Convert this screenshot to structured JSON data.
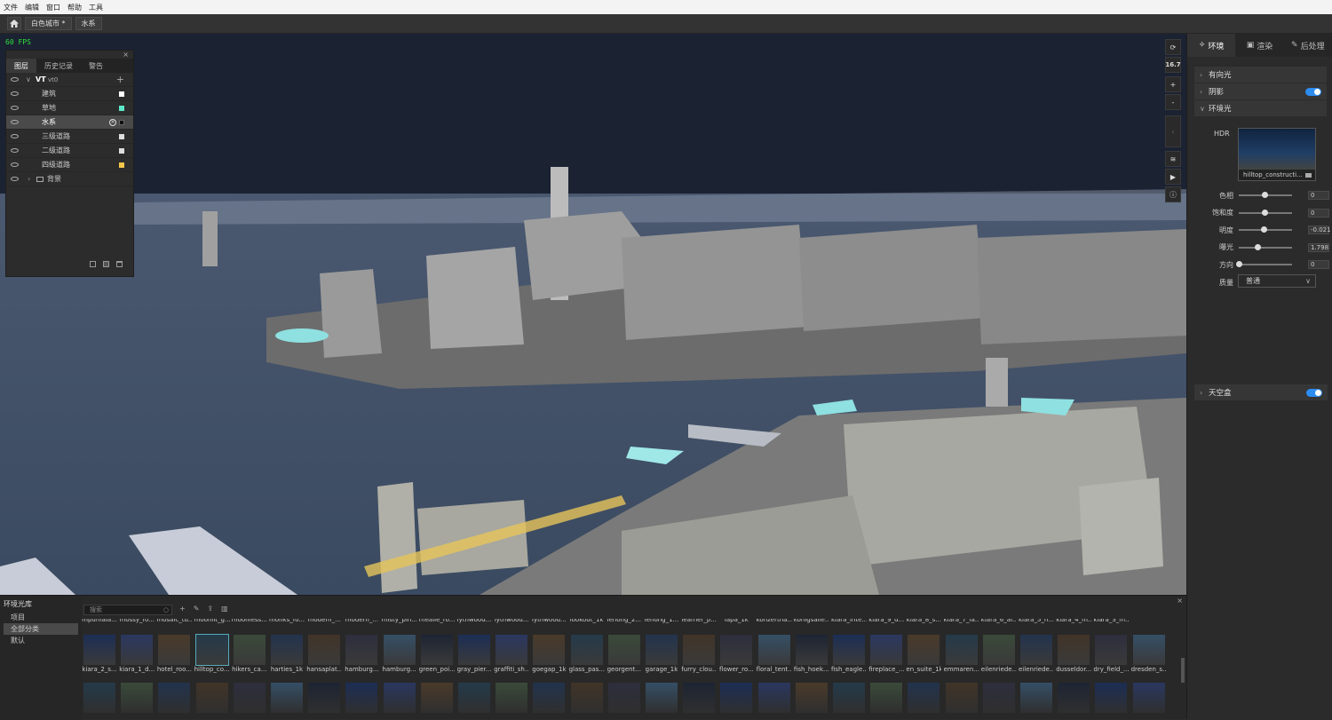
{
  "menu": [
    "文件",
    "编辑",
    "窗口",
    "帮助",
    "工具"
  ],
  "breadcrumb": {
    "city": "白色城市 *",
    "layer": "水系"
  },
  "viewport": {
    "fps": "60 FPS",
    "speed": "16.7"
  },
  "layers": {
    "tabs": [
      "图层",
      "历史记录",
      "警告"
    ],
    "root": {
      "name": "VT",
      "sub": "vt0"
    },
    "items": [
      {
        "label": "建筑",
        "color": "#ffffff"
      },
      {
        "label": "草地",
        "color": "#5ce6c9"
      },
      {
        "label": "水系",
        "color": "#111111"
      },
      {
        "label": "三级道路",
        "color": "#dddddd"
      },
      {
        "label": "二级道路",
        "color": "#dddddd"
      },
      {
        "label": "四级道路",
        "color": "#f2c64a"
      }
    ],
    "background": "背景"
  },
  "right": {
    "tabs": [
      "环境",
      "渲染",
      "后处理"
    ],
    "sections": {
      "directional": "有向光",
      "shadow": "阴影",
      "ambient": "环境光",
      "skybox": "天空盒"
    },
    "hdr_label": "HDR",
    "hdr_name": "hilltop_constructi...",
    "sliders": [
      {
        "label": "色相",
        "value": "0",
        "pos": 0.48
      },
      {
        "label": "饱和度",
        "value": "0",
        "pos": 0.48
      },
      {
        "label": "明度",
        "value": "-0.021",
        "pos": 0.47
      },
      {
        "label": "曝光",
        "value": "1.798",
        "pos": 0.35
      },
      {
        "label": "方向",
        "value": "0",
        "pos": 0.0
      }
    ],
    "quality_label": "质量",
    "quality_value": "普通"
  },
  "library": {
    "title": "环境光库",
    "search_placeholder": "搜索",
    "categories": [
      "项目",
      "全部分类",
      "默认"
    ],
    "row0": [
      "mpumala...",
      "mossy_fo...",
      "mosaic_tu...",
      "moonlit_g...",
      "moonless...",
      "monks_fo...",
      "modern_...",
      "modern_...",
      "misty_pin...",
      "mealie_ro...",
      "lythwood...",
      "lythwood...",
      "lythwood...",
      "lookout_1k",
      "lenong_2...",
      "lenong_1...",
      "learner_p...",
      "lapa_1k",
      "konzertha...",
      "konigsalle...",
      "kiara_inte...",
      "kiara_9_d...",
      "kiara_8_s...",
      "kiara_7_la...",
      "kiara_6_af...",
      "kiara_5_n...",
      "kiara_4_m...",
      "kiara_3_m..."
    ],
    "row1": [
      "kiara_2_s...",
      "kiara_1_d...",
      "hotel_roo...",
      "hilltop_co...",
      "hikers_ca...",
      "harties_1k",
      "hansaplat...",
      "hamburg...",
      "hamburg...",
      "green_poi...",
      "gray_pier...",
      "graffiti_sh...",
      "goegap_1k",
      "glass_pas...",
      "georgent...",
      "garage_1k",
      "furry_clou...",
      "flower_ro...",
      "floral_tent...",
      "fish_hoek...",
      "fish_eagle...",
      "fireplace_...",
      "en_suite_1k",
      "emmaren...",
      "eilenriede...",
      "eilenriede...",
      "dusseldor...",
      "dry_field_...",
      "dresden_s..."
    ]
  }
}
